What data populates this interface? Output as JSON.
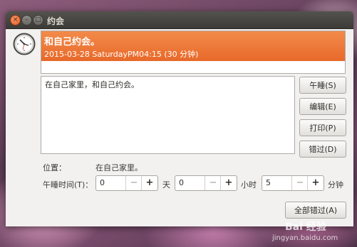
{
  "window": {
    "title": "约会",
    "close_glyph": "×",
    "minimize_glyph": "–",
    "maximize_glyph": "□"
  },
  "header": {
    "title": "和自己约会。",
    "datetime": "2015-03-28 SaturdayPM04:15 (30 分钟)",
    "accent_color": "#ea6f2e"
  },
  "description": "在自己家里，和自己约会。",
  "buttons": {
    "snooze": "午睡(S)",
    "edit": "编辑(E)",
    "print": "打印(P)",
    "dismiss": "错过(D)",
    "dismiss_all": "全部错过(A)"
  },
  "location": {
    "label": "位置：",
    "value": "在自己家里。"
  },
  "snooze_time": {
    "label": "午睡时间(T)：",
    "days": {
      "value": "0",
      "unit": "天"
    },
    "hours": {
      "value": "0",
      "unit": "小时"
    },
    "minutes": {
      "value": "5",
      "unit": "分钟"
    },
    "minus_glyph": "−",
    "plus_glyph": "+"
  },
  "watermark": {
    "brand": "Bai 经验",
    "url": "jingyan.baidu.com"
  },
  "icons": {
    "clock": "clock-icon"
  }
}
